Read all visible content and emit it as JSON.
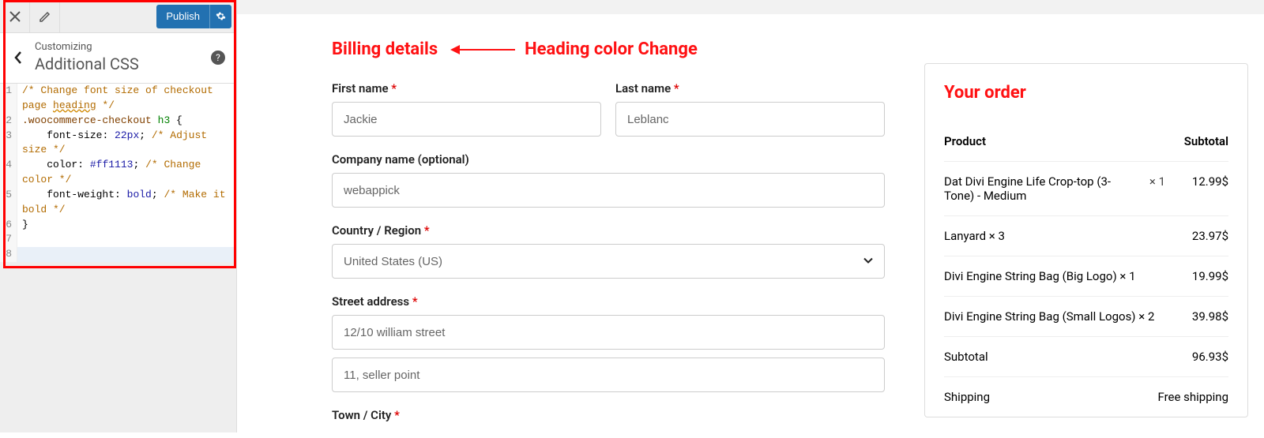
{
  "sidebar": {
    "publish_label": "Publish",
    "customizing_label": "Customizing",
    "title": "Additional CSS",
    "code_lines": [
      {
        "n": "1",
        "segments": [
          {
            "t": "/* Change font size of checkout page ",
            "c": "c-comment"
          },
          {
            "t": "heading",
            "c": "c-comment",
            "ul": true
          },
          {
            "t": " */",
            "c": "c-comment"
          }
        ]
      },
      {
        "n": "2",
        "segments": [
          {
            "t": ".woocommerce-checkout",
            "c": "c-sel"
          },
          {
            "t": " "
          },
          {
            "t": "h3",
            "c": "c-tag"
          },
          {
            "t": " {"
          }
        ]
      },
      {
        "n": "3",
        "segments": [
          {
            "t": "    font-size",
            "c": "c-prop"
          },
          {
            "t": ": "
          },
          {
            "t": "22px",
            "c": "c-val"
          },
          {
            "t": "; "
          },
          {
            "t": "/* Adjust size */",
            "c": "c-comment"
          }
        ]
      },
      {
        "n": "4",
        "segments": [
          {
            "t": "    color",
            "c": "c-prop"
          },
          {
            "t": ": "
          },
          {
            "t": "#ff1113",
            "c": "c-hex"
          },
          {
            "t": "; "
          },
          {
            "t": "/* Change color */",
            "c": "c-comment"
          }
        ]
      },
      {
        "n": "5",
        "segments": [
          {
            "t": "    font-weight",
            "c": "c-prop"
          },
          {
            "t": ": "
          },
          {
            "t": "bold",
            "c": "c-val"
          },
          {
            "t": "; "
          },
          {
            "t": "/* Make it bold */",
            "c": "c-comment"
          }
        ]
      },
      {
        "n": "6",
        "segments": [
          {
            "t": "}"
          }
        ]
      },
      {
        "n": "7",
        "segments": [
          {
            "t": ""
          }
        ]
      },
      {
        "n": "8",
        "segments": [
          {
            "t": ""
          }
        ],
        "current": true
      }
    ]
  },
  "annotation": "Heading color Change",
  "form": {
    "heading": "Billing details",
    "first_name_label": "First name",
    "first_name_value": "Jackie",
    "last_name_label": "Last name",
    "last_name_value": "Leblanc",
    "company_label": "Company name (optional)",
    "company_value": "webappick",
    "country_label": "Country / Region",
    "country_value": "United States (US)",
    "street_label": "Street address",
    "street1_value": "12/10 william street",
    "street2_value": "11, seller point",
    "town_label": "Town / City"
  },
  "order": {
    "heading": "Your order",
    "col_product": "Product",
    "col_subtotal": "Subtotal",
    "items": [
      {
        "name": "Dat Divi Engine Life Crop-top (3-Tone) - Medium",
        "qty": "× 1",
        "price": "12.99$"
      },
      {
        "name": "Lanyard × 3",
        "qty": "",
        "price": "23.97$"
      },
      {
        "name": "Divi Engine String Bag (Big Logo) × 1",
        "qty": "",
        "price": "19.99$"
      },
      {
        "name": "Divi Engine String Bag (Small Logos) × 2",
        "qty": "",
        "price": "39.98$"
      }
    ],
    "subtotal_label": "Subtotal",
    "subtotal_value": "96.93$",
    "shipping_label": "Shipping",
    "shipping_value": "Free shipping"
  }
}
